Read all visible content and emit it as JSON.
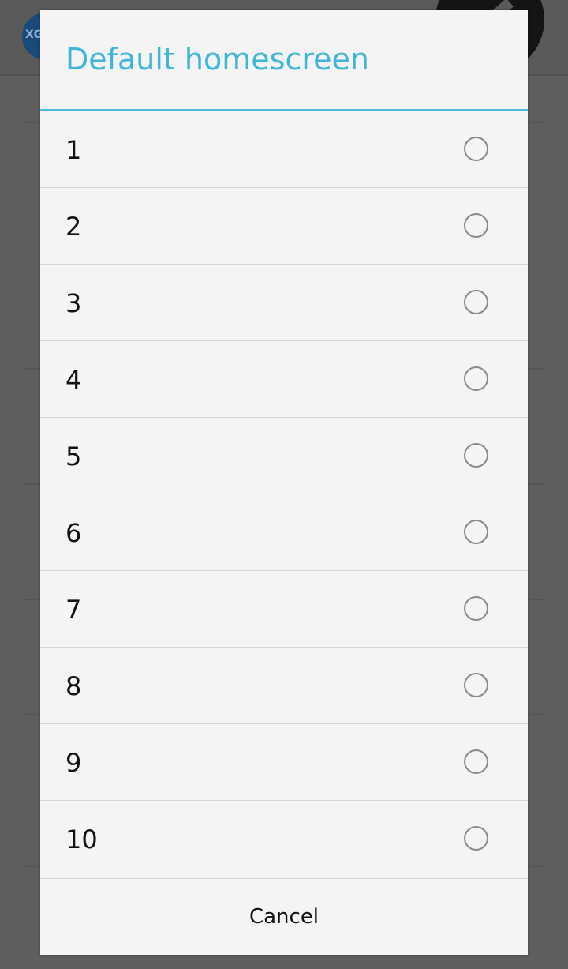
{
  "background": {
    "logo_text": "XG"
  },
  "dialog": {
    "title": "Default homescreen",
    "options": [
      {
        "label": "1",
        "checked": false
      },
      {
        "label": "2",
        "checked": false
      },
      {
        "label": "3",
        "checked": false
      },
      {
        "label": "4",
        "checked": false
      },
      {
        "label": "5",
        "checked": false
      },
      {
        "label": "6",
        "checked": false
      },
      {
        "label": "7",
        "checked": false
      },
      {
        "label": "8",
        "checked": false
      },
      {
        "label": "9",
        "checked": false
      },
      {
        "label": "10",
        "checked": false
      }
    ],
    "cancel_label": "Cancel"
  },
  "colors": {
    "accent": "#3fb6d9",
    "dialog_bg": "#f4f4f4",
    "scrim": "#5e5e5e"
  }
}
